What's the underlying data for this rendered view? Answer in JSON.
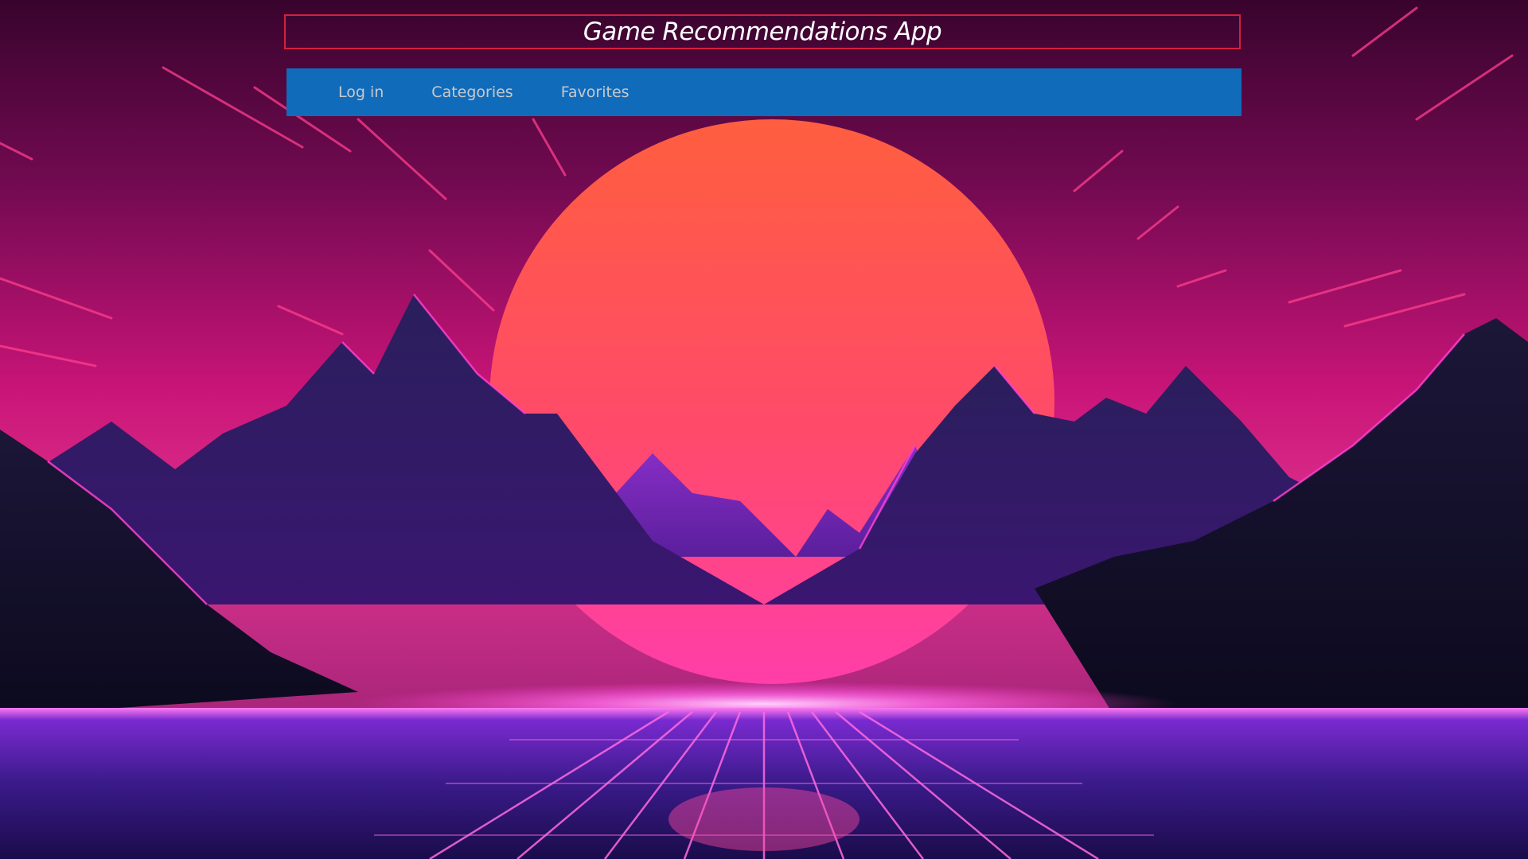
{
  "app": {
    "title": "Game Recommendations App"
  },
  "nav": {
    "items": [
      {
        "label": "Log in",
        "icon": "login"
      },
      {
        "label": "Categories",
        "icon": "categories"
      },
      {
        "label": "Favorites",
        "icon": "favorites"
      }
    ]
  },
  "theme": {
    "header_border": "#d4203f",
    "nav_background": "#116bbb",
    "nav_text": "#c9c9c9",
    "sky_top": "#3b0530",
    "sky_bottom": "#e02a8a",
    "sun_top": "#ff5f45",
    "sun_bottom": "#ff3f9e",
    "mountain_dark": "#1a1035",
    "mountain_mid": "#2a1a5a",
    "grid_glow": "#ff5ee0",
    "floor": "#2a1466"
  }
}
